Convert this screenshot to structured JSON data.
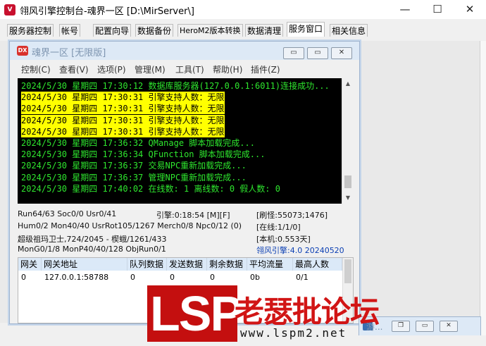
{
  "window": {
    "title": "翎风引擎控制台-魂界一区 [D:\\MirServer\\]",
    "minimize": "—",
    "maximize": "☐",
    "close": "✕"
  },
  "tabs": [
    {
      "label": "服务器控制"
    },
    {
      "label": "帐号"
    },
    {
      "label": "配置向导"
    },
    {
      "label": "数据备份"
    },
    {
      "label": "HeroM2版本转换"
    },
    {
      "label": "数据清理"
    },
    {
      "label": "服务窗口",
      "active": true
    },
    {
      "label": "相关信息"
    }
  ],
  "child": {
    "icon_text": "DX",
    "title": "魂界一区 [无限版]",
    "btn_min": "▭",
    "btn_restore": "▭",
    "btn_close": "✕",
    "menu": [
      "控制(C)",
      "查看(V)",
      "选项(P)",
      "管理(M)",
      "工具(T)",
      "帮助(H)",
      "插件(Z)"
    ],
    "log": [
      {
        "text": "2024/5/30 星期四 17:30:12 数据库服务器(127.0.0.1:6011)连接成功...",
        "style": "green"
      },
      {
        "text": "2024/5/30 星期四 17:30:31 引擎支持人数：无限",
        "style": "yellow"
      },
      {
        "text": "2024/5/30 星期四 17:30:31 引擎支持人数：无限",
        "style": "yellow"
      },
      {
        "text": "2024/5/30 星期四 17:30:31 引擎支持人数：无限",
        "style": "yellow"
      },
      {
        "text": "2024/5/30 星期四 17:30:31 引擎支持人数：无限",
        "style": "yellow"
      },
      {
        "text": "2024/5/30 星期四 17:36:32 QManage 脚本加载完成...",
        "style": "green"
      },
      {
        "text": "2024/5/30 星期四 17:36:34 QFunction 脚本加载完成...",
        "style": "green"
      },
      {
        "text": "2024/5/30 星期四 17:36:37 交易NPC重新加载完成...",
        "style": "green"
      },
      {
        "text": "2024/5/30 星期四 17:36:37 管理NPC重新加载完成...",
        "style": "green"
      },
      {
        "text": "2024/5/30 星期四 17:40:02 在线数: 1 离线数: 0 假人数: 0",
        "style": "green"
      }
    ],
    "status": {
      "run": "Run64/63 Soc0/0 Usr0/41",
      "engine_time": "引擎:0:18:54 [M][F]",
      "refresh": "[刷怪:55073;1476]",
      "hum": "Hum0/2 Mon40/40 UsrRot105/1267 Merch0/8 Npc0/12 (0)",
      "online": "[在线:1/1/0]",
      "guard": "超级祖玛卫士,724/2045 - 楔蛾/1261/433",
      "local": "[本机:0.553天]",
      "mon": "MonG0/1/8 MonP40/40/128 ObjRun0/1",
      "version": "翎风引擎:4.0 20240520"
    },
    "grid": {
      "headers": [
        "网关",
        "网关地址",
        "队列数据",
        "发送数据",
        "剩余数据",
        "平均流量",
        "最高人数"
      ],
      "rows": [
        [
          "0",
          "127.0.0.1:58788",
          "0",
          "0",
          "0",
          "0b",
          "0/1"
        ]
      ]
    }
  },
  "watermark": {
    "logo": "LSP",
    "brand": "老瑟批论坛",
    "url": "www.lspm2.net"
  },
  "minimized_child": {
    "title": "游..."
  }
}
